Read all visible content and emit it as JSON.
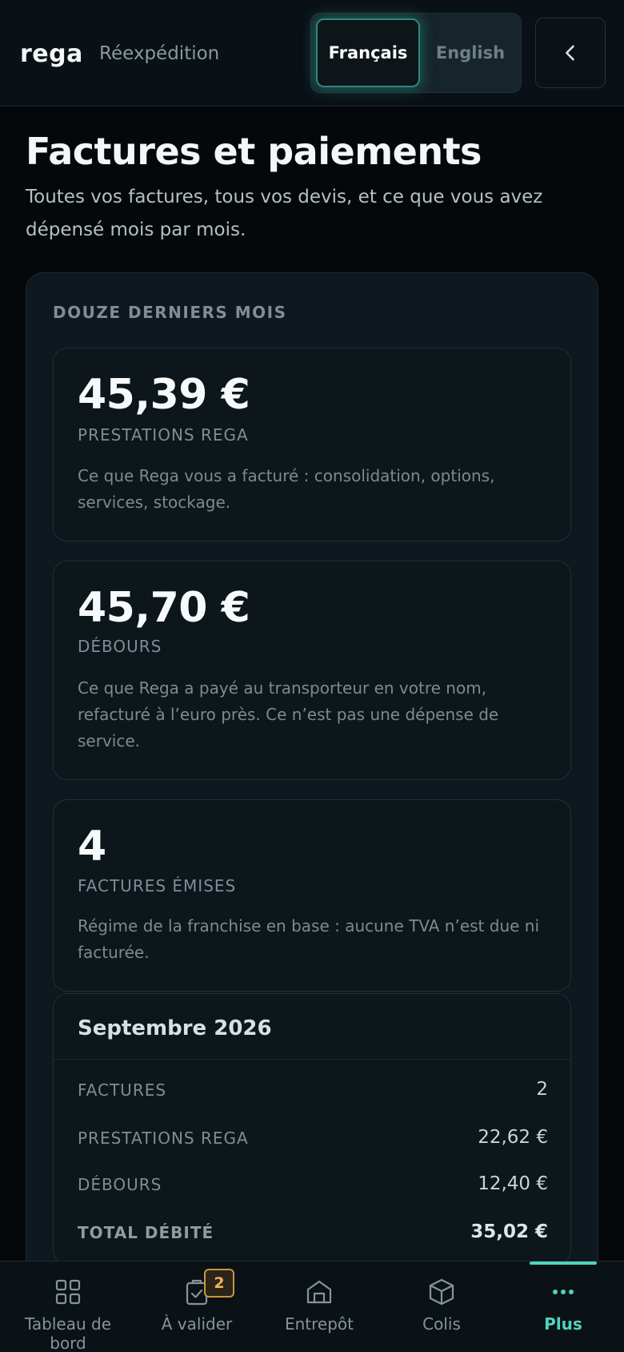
{
  "header": {
    "brand": "rega",
    "subtitle": "Réexpédition",
    "languages": [
      "Français",
      "English"
    ],
    "active_language": "Français",
    "back_icon": "chevron-left-icon"
  },
  "page": {
    "title": "Factures et paiements",
    "description": "Toutes vos factures, tous vos devis, et ce que vous avez dépensé mois par mois."
  },
  "summary": {
    "label": "DOUZE DERNIERS MOIS",
    "stats": [
      {
        "value": "45,39 €",
        "label": "PRESTATIONS REGA",
        "description": "Ce que Rega vous a facturé : consolidation, options, services, stockage."
      },
      {
        "value": "45,70 €",
        "label": "DÉBOURS",
        "description": "Ce que Rega a payé au transporteur en votre nom, refacturé à l’euro près. Ce n’est pas une dépense de service."
      },
      {
        "value": "4",
        "label": "FACTURES ÉMISES",
        "description": "Régime de la franchise en base : aucune TVA n’est due ni facturée."
      }
    ]
  },
  "month": {
    "title": "Septembre 2026",
    "rows": [
      {
        "label": "FACTURES",
        "value": "2"
      },
      {
        "label": "PRESTATIONS REGA",
        "value": "22,62 €"
      },
      {
        "label": "DÉBOURS",
        "value": "12,40 €"
      },
      {
        "label": "TOTAL DÉBITÉ",
        "value": "35,02 €"
      }
    ]
  },
  "nav": {
    "items": [
      {
        "label": "Tableau de bord",
        "icon": "grid-icon"
      },
      {
        "label": "À valider",
        "icon": "clipboard-check-icon",
        "badge": "2"
      },
      {
        "label": "Entrepôt",
        "icon": "warehouse-icon"
      },
      {
        "label": "Colis",
        "icon": "package-icon"
      },
      {
        "label": "Plus",
        "icon": "more-dots-icon"
      }
    ],
    "active": "Plus"
  },
  "colors": {
    "accent": "#4fd4bd",
    "badge": "#f0b455",
    "background": "#05080a"
  }
}
